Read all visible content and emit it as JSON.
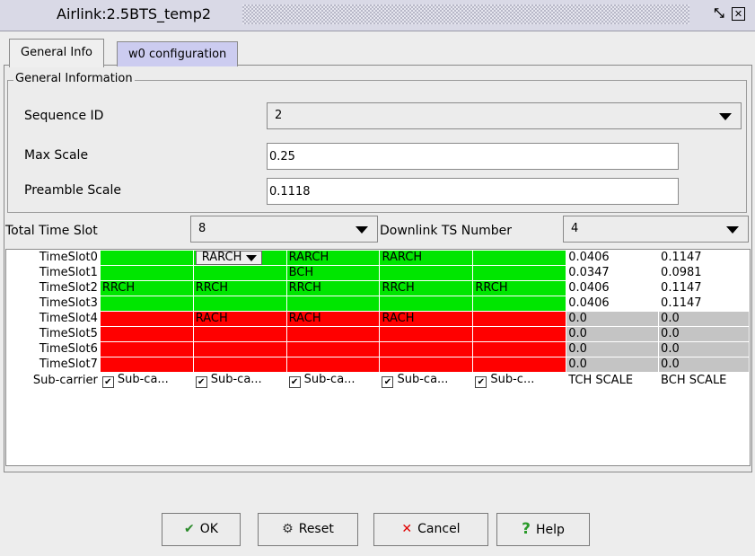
{
  "window": {
    "title": "Airlink:2.5BTS_temp2"
  },
  "tabs": [
    {
      "label": "General Info"
    },
    {
      "label": "w0 configuration"
    }
  ],
  "general": {
    "legend": "General Information",
    "sequence_id_label": "Sequence ID",
    "sequence_id_value": "2",
    "max_scale_label": "Max Scale",
    "max_scale_value": "0.25",
    "preamble_scale_label": "Preamble Scale",
    "preamble_scale_value": "0.1118"
  },
  "timeslots": {
    "total_label": "Total Time Slot",
    "total_value": "8",
    "downlink_label": "Downlink TS Number",
    "downlink_value": "4"
  },
  "grid": {
    "rows": [
      {
        "label": "TimeSlot0",
        "cells": [
          "",
          "RARCH",
          "RARCH",
          "RARCH",
          ""
        ],
        "tch": "0.0406",
        "bch": "0.1147",
        "color": "green"
      },
      {
        "label": "TimeSlot1",
        "cells": [
          "",
          "",
          "BCH",
          "",
          ""
        ],
        "tch": "0.0347",
        "bch": "0.0981",
        "color": "green"
      },
      {
        "label": "TimeSlot2",
        "cells": [
          "RRCH",
          "RRCH",
          "RRCH",
          "RRCH",
          "RRCH"
        ],
        "tch": "0.0406",
        "bch": "0.1147",
        "color": "green"
      },
      {
        "label": "TimeSlot3",
        "cells": [
          "",
          "",
          "",
          "",
          ""
        ],
        "tch": "0.0406",
        "bch": "0.1147",
        "color": "green"
      },
      {
        "label": "TimeSlot4",
        "cells": [
          "",
          "RACH",
          "RACH",
          "RACH",
          ""
        ],
        "tch": "0.0",
        "bch": "0.0",
        "color": "red"
      },
      {
        "label": "TimeSlot5",
        "cells": [
          "",
          "",
          "",
          "",
          ""
        ],
        "tch": "0.0",
        "bch": "0.0",
        "color": "red"
      },
      {
        "label": "TimeSlot6",
        "cells": [
          "",
          "",
          "",
          "",
          ""
        ],
        "tch": "0.0",
        "bch": "0.0",
        "color": "red"
      },
      {
        "label": "TimeSlot7",
        "cells": [
          "",
          "",
          "",
          "",
          ""
        ],
        "tch": "0.0",
        "bch": "0.0",
        "color": "red"
      }
    ],
    "subcarrier_label": "Sub-carrier",
    "subcarriers": [
      "Sub-ca...",
      "Sub-ca...",
      "Sub-ca...",
      "Sub-ca...",
      "Sub-c..."
    ],
    "tch_scale_label": "TCH SCALE",
    "bch_scale_label": "BCH SCALE"
  },
  "buttons": {
    "ok": "OK",
    "reset": "Reset",
    "cancel": "Cancel",
    "help": "Help"
  },
  "colors": {
    "green": "#00e600",
    "red": "#ff0000",
    "gray": "#c4c4c4",
    "tab_inactive": "#ccccf0"
  }
}
